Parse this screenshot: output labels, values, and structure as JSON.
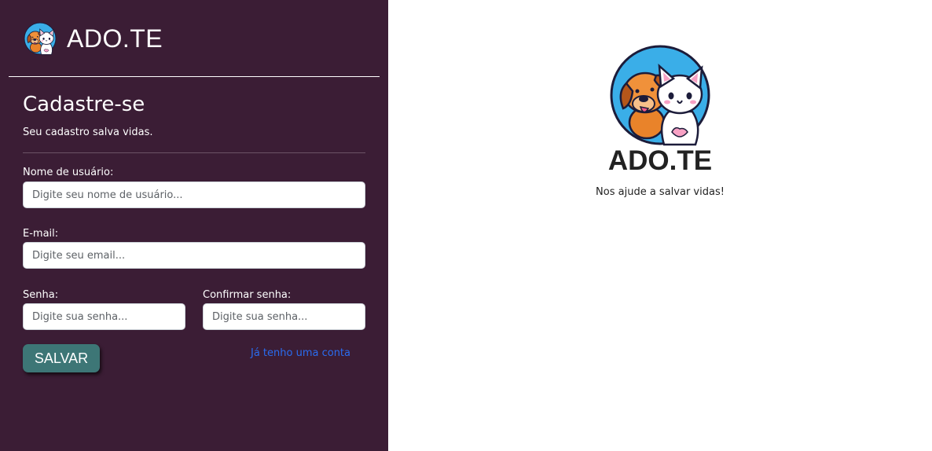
{
  "app": {
    "brand_name": "ADO.TE",
    "colors": {
      "sidebar_bg": "#3b1d35",
      "button_bg": "#3d7676",
      "link": "#2a6cf0",
      "logo_circle": "#3aaee8"
    },
    "logo_icon": "dog-and-cat-logo-icon"
  },
  "form": {
    "title": "Cadastre-se",
    "subtitle": "Seu cadastro salva vidas.",
    "username": {
      "label": "Nome de usuário:",
      "placeholder": "Digite seu nome de usuário...",
      "value": ""
    },
    "email": {
      "label": "E-mail:",
      "placeholder": "Digite seu email...",
      "value": ""
    },
    "password": {
      "label": "Senha:",
      "placeholder": "Digite sua senha...",
      "value": ""
    },
    "confirm_password": {
      "label": "Confirmar senha:",
      "placeholder": "Digite sua senha...",
      "value": ""
    },
    "save_label": "SALVAR",
    "login_link": "Já tenho uma conta"
  },
  "hero": {
    "name": "ADO.TE",
    "tagline": "Nos ajude a salvar vidas!"
  }
}
